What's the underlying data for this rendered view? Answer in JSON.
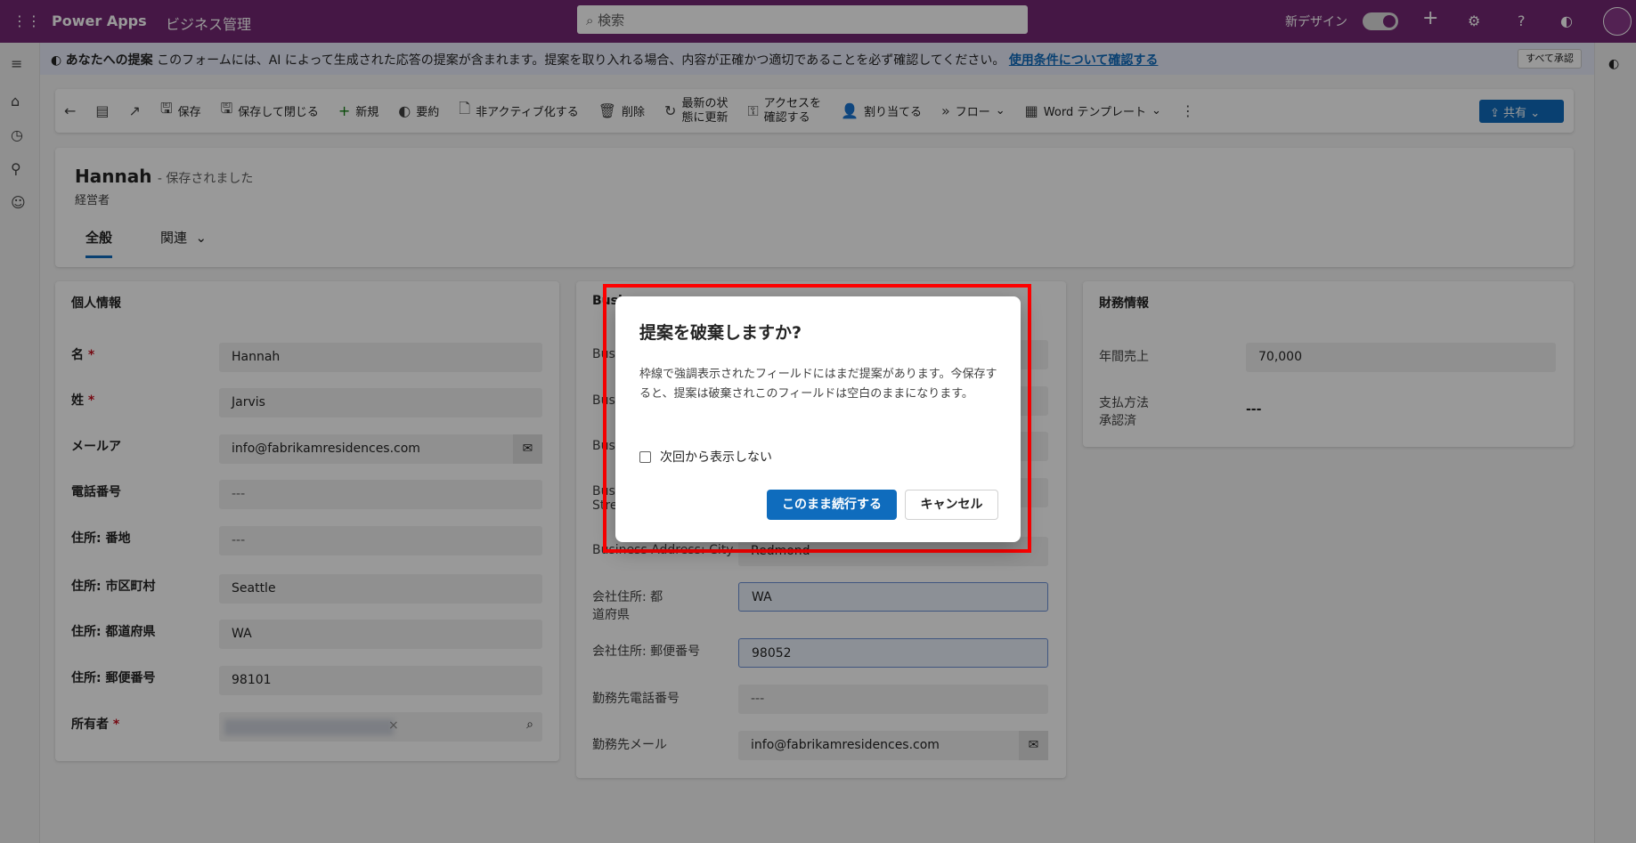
{
  "topbar": {
    "app": "Power Apps",
    "env": "ビジネス管理",
    "search_placeholder": "検索",
    "new_design": "新デザイン",
    "new_design_on": true
  },
  "banner": {
    "title": "あなたへの提案",
    "text": "このフォームには、AI によって生成された応答の提案が含まれます。提案を取り入れる場合、内容が正確かつ適切であることを必ず確認してください。",
    "link": "使用条件について確認する",
    "accept_all": "すべて承認"
  },
  "toolbar": {
    "save": "保存",
    "save_close": "保存して閉じる",
    "new": "新規",
    "summary": "要約",
    "deactivate": "非アクティブ化する",
    "delete": "削除",
    "refresh1": "最新の状",
    "refresh2": "態に更新",
    "access1": "アクセスを",
    "access2": "確認する",
    "assign": "割り当てる",
    "flow": "フロー",
    "word": "Word テンプレート",
    "share": "共有"
  },
  "record": {
    "name": "Hannah",
    "status": "- 保存されました",
    "subtitle": "経営者",
    "tabs": [
      "全般",
      "関連"
    ]
  },
  "personal": {
    "title": "個人情報",
    "fields": [
      {
        "label": "名",
        "required": true,
        "value": "Hannah"
      },
      {
        "label": "姓",
        "required": true,
        "value": "Jarvis"
      },
      {
        "label": "メールア",
        "value": "info@fabrikamresidences.com"
      },
      {
        "label": "電話番号",
        "value": "---"
      },
      {
        "label": "住所: 番地",
        "value": "---"
      },
      {
        "label": "住所: 市区町村",
        "value": "Seattle"
      },
      {
        "label": "住所: 都道府県",
        "value": "WA"
      },
      {
        "label": "住所: 郵便番号",
        "value": "98101"
      },
      {
        "label": "所有者",
        "required": true,
        "value": ""
      }
    ]
  },
  "business": {
    "title": "Busi",
    "fields": [
      {
        "label": "Bus",
        "value": ""
      },
      {
        "label": "Bus",
        "value": ""
      },
      {
        "label": "Bus",
        "value": ""
      },
      {
        "label": "Bus Stre",
        "value": ""
      },
      {
        "label": "Business Address: City",
        "value": "Redmond"
      },
      {
        "label": "会社住所: 都道府県",
        "value": "WA"
      },
      {
        "label": "会社住所: 郵便番号",
        "value": "98052"
      },
      {
        "label": "勤務先電話番号",
        "value": "---"
      },
      {
        "label": "勤務先メール",
        "value": "info@fabrikamresidences.com"
      }
    ]
  },
  "finance": {
    "title": "財務情報",
    "fields": [
      {
        "label": "年間売上",
        "value": "70,000"
      },
      {
        "label": "支払方法 承認済",
        "value": "---"
      }
    ]
  },
  "dialog": {
    "title": "提案を破棄しますか?",
    "body": "枠線で強調表示されたフィールドにはまだ提案があります。今保存すると、提案は破棄されこのフィールドは空白のままになります。",
    "checkbox": "次回から表示しない",
    "checked": false,
    "continue": "このまま続行する",
    "cancel": "キャンセル"
  },
  "colors": {
    "brand": "#742774",
    "accent": "#0f6cbd",
    "highlight": "#ff0000"
  }
}
